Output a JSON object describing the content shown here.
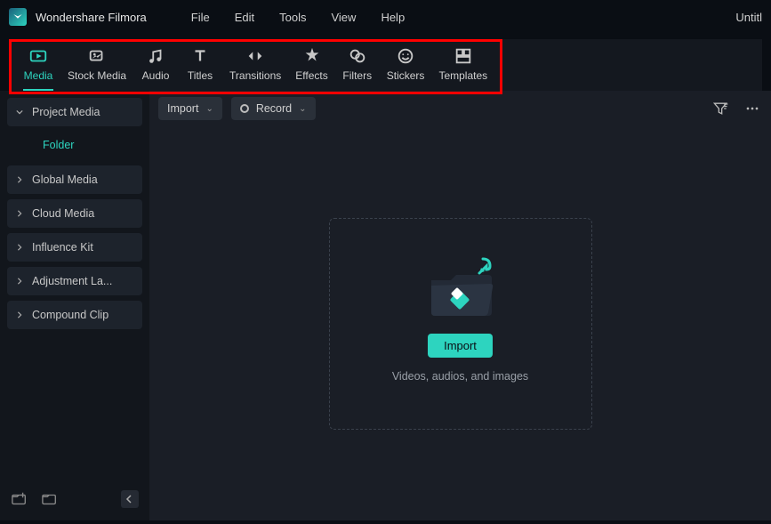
{
  "app": {
    "name": "Wondershare Filmora",
    "title_right": "Untitl"
  },
  "menu": {
    "file": "File",
    "edit": "Edit",
    "tools": "Tools",
    "view": "View",
    "help": "Help"
  },
  "tabs": {
    "media": "Media",
    "stock_media": "Stock Media",
    "audio": "Audio",
    "titles": "Titles",
    "transitions": "Transitions",
    "effects": "Effects",
    "filters": "Filters",
    "stickers": "Stickers",
    "templates": "Templates"
  },
  "sidebar": {
    "project_media": "Project Media",
    "folder": "Folder",
    "global_media": "Global Media",
    "cloud_media": "Cloud Media",
    "influence_kit": "Influence Kit",
    "adjustment_layer": "Adjustment La...",
    "compound_clip": "Compound Clip"
  },
  "content_toolbar": {
    "import": "Import",
    "record": "Record"
  },
  "dropzone": {
    "import_button": "Import",
    "hint": "Videos, audios, and images"
  }
}
